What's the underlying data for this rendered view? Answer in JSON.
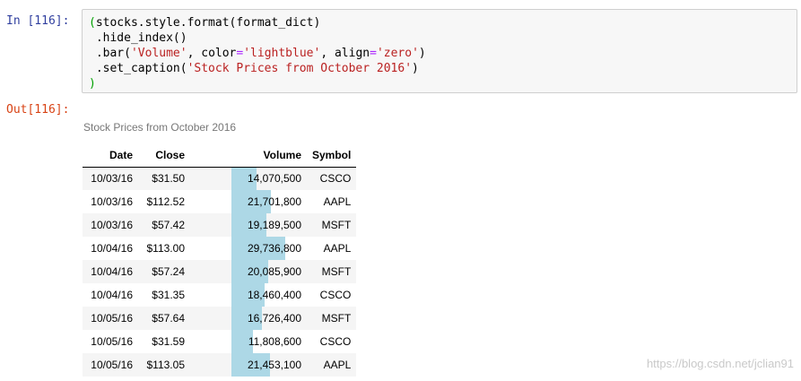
{
  "cell": {
    "in_prompt": "In [116]:",
    "out_prompt": "Out[116]:",
    "code": {
      "line1_open": "(",
      "line1_text": "stocks.style.format(format_dict)",
      "line2": ".hide_index()",
      "line3_a": ".bar(",
      "line3_s1": "'Volume'",
      "line3_b": ", color",
      "line3_eq1": "=",
      "line3_s2": "'lightblue'",
      "line3_c": ", align",
      "line3_eq2": "=",
      "line3_s3": "'zero'",
      "line3_d": ")",
      "line4_a": ".set_caption(",
      "line4_s": "'Stock Prices from October 2016'",
      "line4_b": ")",
      "line5_close": ")"
    }
  },
  "table": {
    "caption": "Stock Prices from October 2016",
    "columns": [
      "Date",
      "Close",
      "Volume",
      "Symbol"
    ],
    "bar_color": "#add8e6",
    "rows": [
      {
        "date": "10/03/16",
        "close": "$31.50",
        "volume": "14,070,500",
        "symbol": "CSCO",
        "volume_value": 14070500
      },
      {
        "date": "10/03/16",
        "close": "$112.52",
        "volume": "21,701,800",
        "symbol": "AAPL",
        "volume_value": 21701800
      },
      {
        "date": "10/03/16",
        "close": "$57.42",
        "volume": "19,189,500",
        "symbol": "MSFT",
        "volume_value": 19189500
      },
      {
        "date": "10/04/16",
        "close": "$113.00",
        "volume": "29,736,800",
        "symbol": "AAPL",
        "volume_value": 29736800
      },
      {
        "date": "10/04/16",
        "close": "$57.24",
        "volume": "20,085,900",
        "symbol": "MSFT",
        "volume_value": 20085900
      },
      {
        "date": "10/04/16",
        "close": "$31.35",
        "volume": "18,460,400",
        "symbol": "CSCO",
        "volume_value": 18460400
      },
      {
        "date": "10/05/16",
        "close": "$57.64",
        "volume": "16,726,400",
        "symbol": "MSFT",
        "volume_value": 16726400
      },
      {
        "date": "10/05/16",
        "close": "$31.59",
        "volume": "11,808,600",
        "symbol": "CSCO",
        "volume_value": 11808600
      },
      {
        "date": "10/05/16",
        "close": "$113.05",
        "volume": "21,453,100",
        "symbol": "AAPL",
        "volume_value": 21453100
      }
    ]
  },
  "watermark": "https://blog.csdn.net/jclian91"
}
